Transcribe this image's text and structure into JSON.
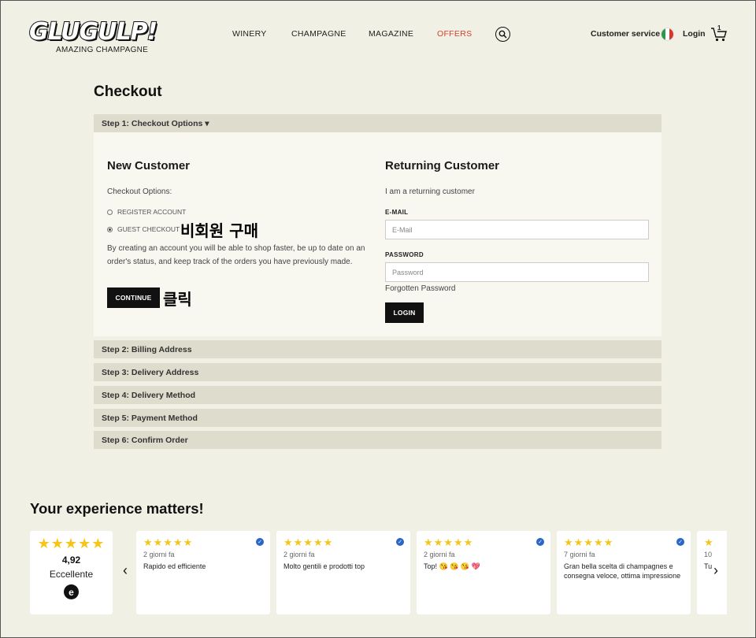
{
  "header": {
    "logo_word": "GLUGULP!",
    "logo_tagline": "AMAZING CHAMPAGNE",
    "nav": [
      "WINERY",
      "CHAMPAGNE",
      "MAGAZINE",
      "OFFERS"
    ],
    "customer_service": "Customer service",
    "login": "Login",
    "cart_count": "1",
    "icons": [
      "search-icon",
      "italy-flag-icon",
      "cart-icon"
    ]
  },
  "checkout": {
    "title": "Checkout",
    "step1": "Step 1: Checkout Options ▾",
    "new_customer": {
      "title": "New Customer",
      "options_label": "Checkout Options:",
      "register": "REGISTER ACCOUNT",
      "guest": "GUEST CHECKOUT",
      "guest_selected": true,
      "annotation_guest": "비회원 구매",
      "description": "By creating an account you will be able to shop faster, be up to date on an order's status, and keep track of the orders you have previously made.",
      "continue": "CONTINUE",
      "annotation_click": "클릭"
    },
    "returning_customer": {
      "title": "Returning Customer",
      "subtitle": "I am a returning customer",
      "email_label": "E-MAIL",
      "email_placeholder": "E-Mail",
      "password_label": "PASSWORD",
      "password_placeholder": "Password",
      "forgotten": "Forgotten Password",
      "login_button": "LOGIN"
    },
    "steps": [
      "Step 2: Billing Address",
      "Step 3: Delivery Address",
      "Step 4: Delivery Method",
      "Step 5: Payment Method",
      "Step 6: Confirm Order"
    ]
  },
  "reviews": {
    "title": "Your experience matters!",
    "summary": {
      "stars": "★★★★★",
      "score": "4,92",
      "rating": "Eccellente",
      "logo_glyph": "e"
    },
    "cards": [
      {
        "stars": "★★★★★",
        "time": "2 giorni fa",
        "text": "Rapido ed efficiente"
      },
      {
        "stars": "★★★★★",
        "time": "2 giorni fa",
        "text": "Molto gentili e prodotti top"
      },
      {
        "stars": "★★★★★",
        "time": "2 giorni fa",
        "text": "Top! 😘 😘 😘 💖"
      },
      {
        "stars": "★★★★★",
        "time": "7 giorni fa",
        "text": "Gran bella scelta di champagnes e consegna veloce, ottima impressione"
      },
      {
        "stars": "★",
        "time": "10",
        "text": "Tu"
      }
    ],
    "prev": "‹",
    "next": "›"
  },
  "colors": {
    "background": "#f1f0e4",
    "step_bar": "#dddccd",
    "offers": "#d6402e",
    "star": "#f5c518",
    "button": "#111111"
  }
}
